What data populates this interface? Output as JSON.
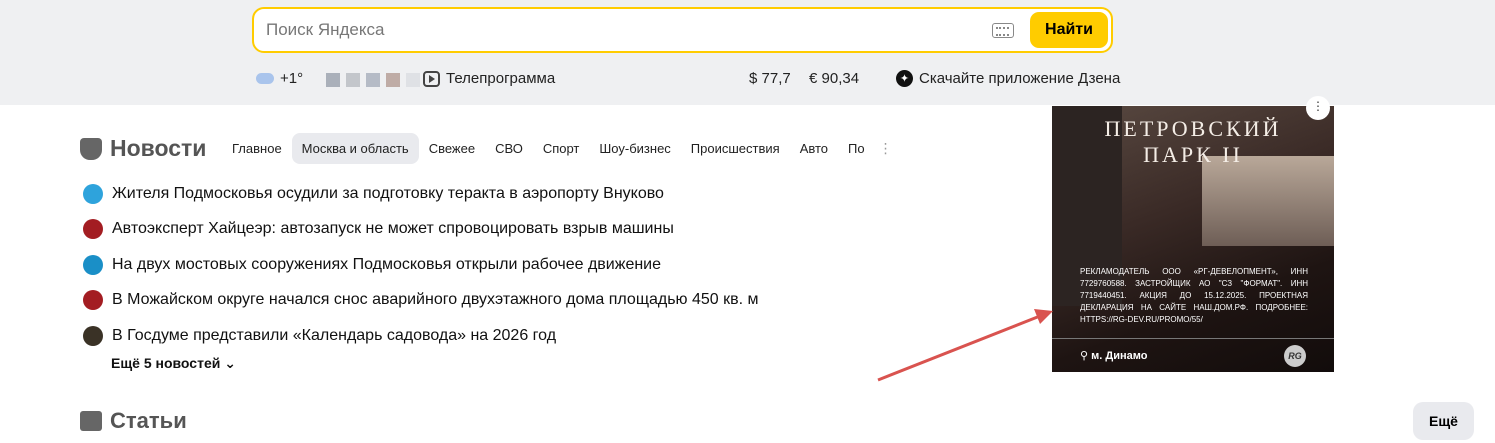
{
  "search": {
    "placeholder": "Поиск Яндекса",
    "button": "Найти"
  },
  "informers": {
    "weather": "+1°",
    "tv": "Телепрограмма",
    "usd": "$ 77,7",
    "eur": "€ 90,34",
    "zen": "Скачайте приложение Дзена"
  },
  "news": {
    "title": "Новости",
    "tabs": [
      "Главное",
      "Москва и область",
      "Свежее",
      "СВО",
      "Спорт",
      "Шоу-бизнес",
      "Происшествия",
      "Авто",
      "По"
    ],
    "active_tab": "Москва и область",
    "items": [
      {
        "text": "Жителя Подмосковья осудили за подготовку теракта в аэропорту Внуково",
        "color": "#2ea3dc"
      },
      {
        "text": "Автоэксперт Хайцеэр: автозапуск не может спровоцировать взрыв машины",
        "color": "#a31d22"
      },
      {
        "text": "На двух мостовых сооружениях Подмосковья открыли рабочее движение",
        "color": "#1a8fc7"
      },
      {
        "text": "В Можайском округе начался снос аварийного двухэтажного дома площадью 450 кв. м",
        "color": "#a31d22"
      },
      {
        "text": "В Госдуме представили «Календарь садовода» на 2026 год",
        "color": "#3a3226"
      }
    ],
    "more": "Ещё 5 новостей"
  },
  "articles": {
    "title": "Статьи"
  },
  "ad": {
    "title1": "ПЕТРОВСКИЙ",
    "title2": "ПАРК II",
    "legal": "Рекламодатель ООО «РГ-Девелопмент», ИНН 7729760588. Застройщик АО \"СЗ \"Формат\". ИНН 7719440451. Акция до 15.12.2025. Проектная декларация на сайте наш.дом.рф. Подробнее: https://rg-dev.ru/promo/55/",
    "location": "м. Динамо",
    "logo": "RG"
  },
  "more_button": "Ещё",
  "annotation_color": "#d9534f"
}
